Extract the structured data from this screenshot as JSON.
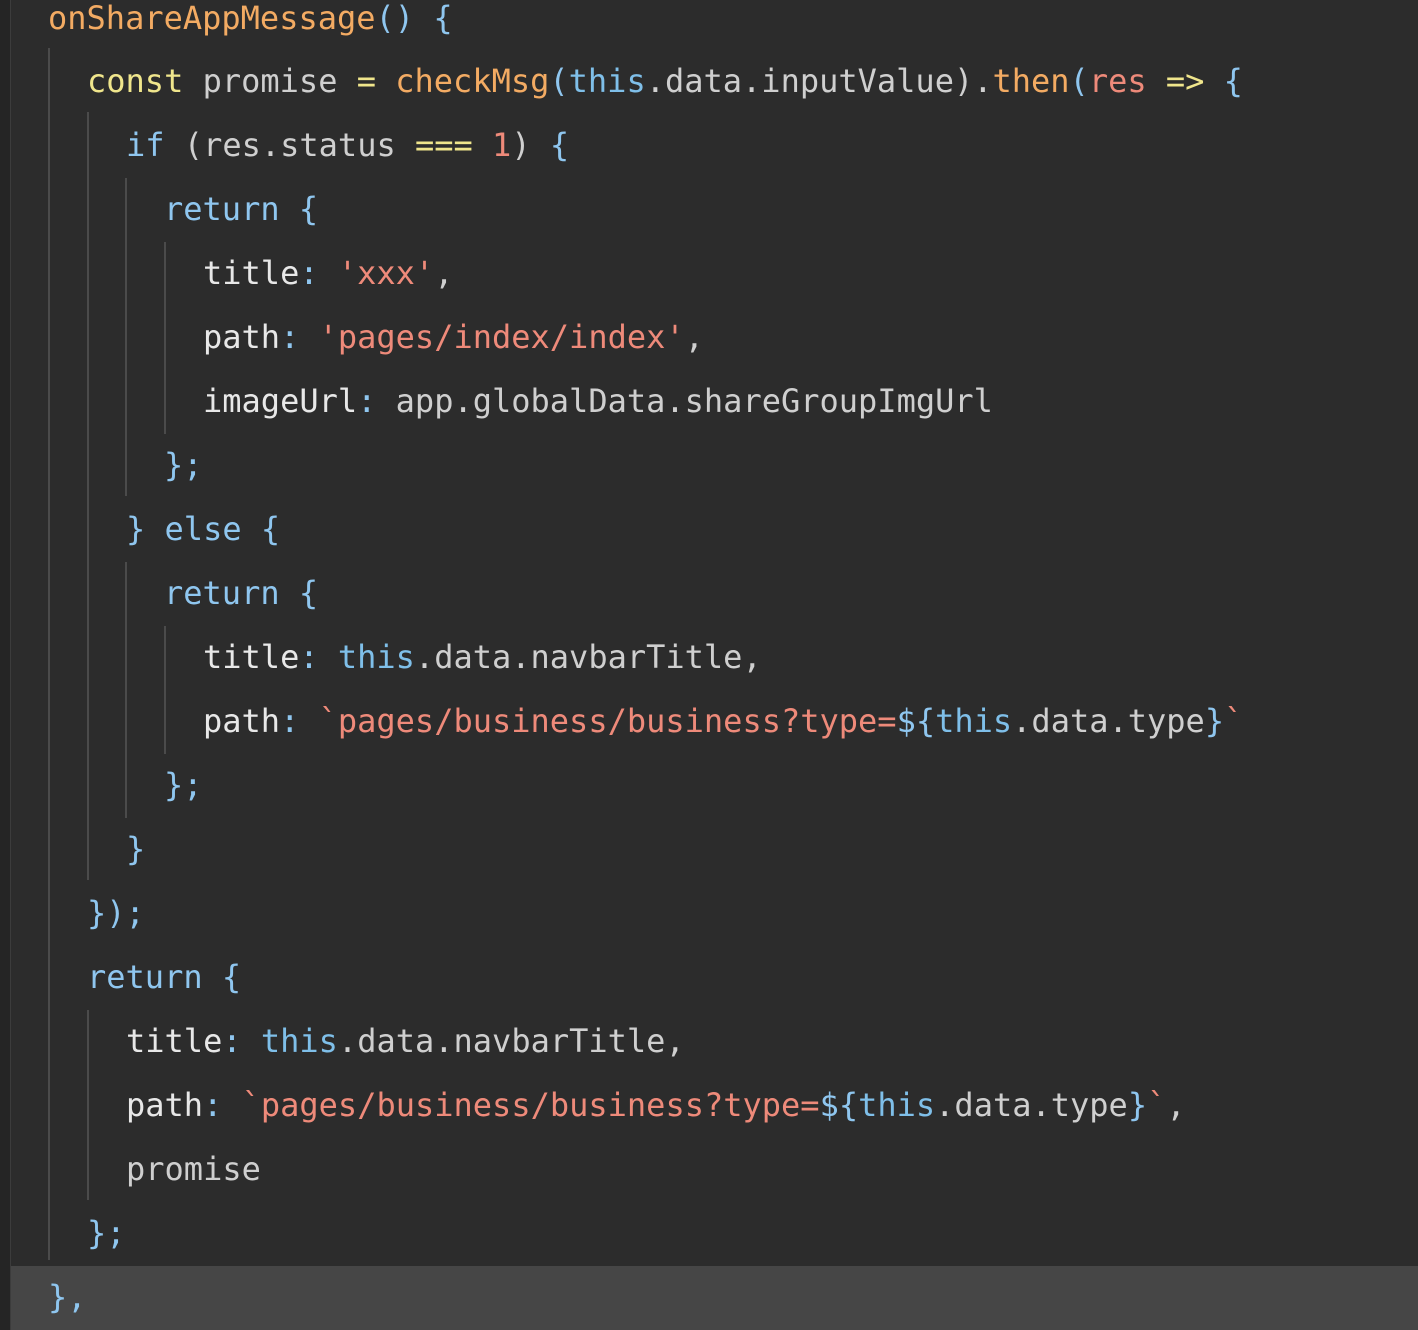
{
  "code": {
    "l1": {
      "fn": "onShareAppMessage",
      "parens": "()",
      "brace": "{"
    },
    "l2": {
      "kw": "const",
      "name": "promise",
      "eq": "=",
      "fn": "checkMsg",
      "lp": "(",
      "this": "this",
      "d1": ".",
      "data": "data",
      "d2": ".",
      "prop": "inputValue",
      "rp": ")",
      "d3": ".",
      "then": "then",
      "lp2": "(",
      "param": "res",
      "arrow": "=>",
      "brace": "{"
    },
    "l3": {
      "kw": "if",
      "lp": "(",
      "obj": "res",
      "dot": ".",
      "prop": "status",
      "op": "===",
      "num": "1",
      "rp": ")",
      "brace": "{"
    },
    "l4": {
      "kw": "return",
      "brace": "{"
    },
    "l5": {
      "key": "title",
      "colon": ":",
      "str": "'xxx'",
      "comma": ","
    },
    "l6": {
      "key": "path",
      "colon": ":",
      "str": "'pages/index/index'",
      "comma": ","
    },
    "l7": {
      "key": "imageUrl",
      "colon": ":",
      "value": "app.globalData.shareGroupImgUrl"
    },
    "l8": {
      "close": "};"
    },
    "l9": {
      "close": "}",
      "kw": "else",
      "brace": "{"
    },
    "l10": {
      "kw": "return",
      "brace": "{"
    },
    "l11": {
      "key": "title",
      "colon": ":",
      "this": "this",
      "rest": ".data.navbarTitle",
      "comma": ","
    },
    "l12": {
      "key": "path",
      "colon": ":",
      "str": "`pages/business/business?type=",
      "tplOpen": "${",
      "this": "this",
      "rest": ".data.type",
      "tplClose": "}",
      "tick": "`"
    },
    "l13": {
      "close": "};"
    },
    "l14": {
      "close": "}"
    },
    "l15": {
      "close": "});"
    },
    "l16": {
      "kw": "return",
      "brace": "{"
    },
    "l17": {
      "key": "title",
      "colon": ":",
      "this": "this",
      "rest": ".data.navbarTitle",
      "comma": ","
    },
    "l18": {
      "key": "path",
      "colon": ":",
      "str": "`pages/business/business?type=",
      "tplOpen": "${",
      "this": "this",
      "rest": ".data.type",
      "tplClose": "}",
      "tick": "`",
      "comma": ","
    },
    "l19": {
      "value": "promise"
    },
    "l20": {
      "close": "};"
    },
    "l21": {
      "close": "},"
    }
  }
}
